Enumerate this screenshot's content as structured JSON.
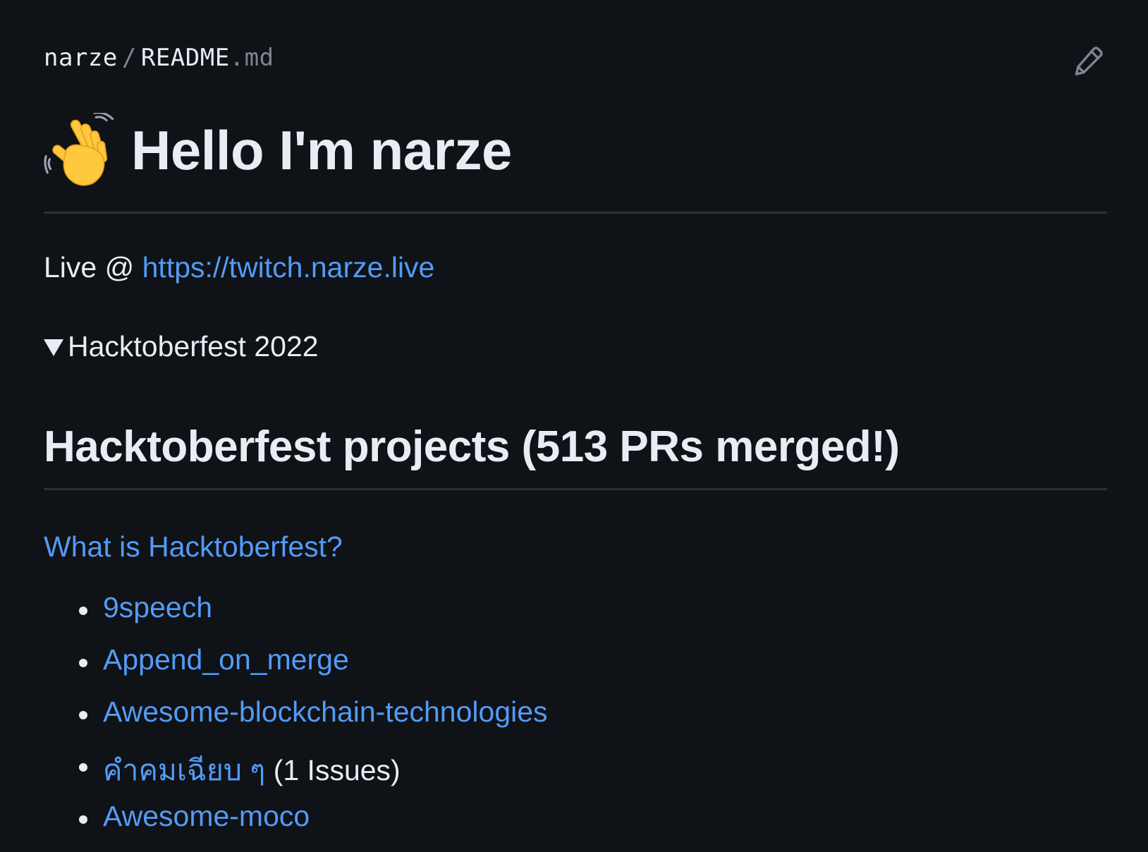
{
  "breadcrumb": {
    "owner": "narze",
    "separator": "/",
    "file_base": "README",
    "file_ext": ".md"
  },
  "header": {
    "title": "Hello I'm narze",
    "title_icon": "waving-hand-icon",
    "edit_icon": "pencil-icon"
  },
  "live": {
    "prefix": "Live @ ",
    "url_text": "https://twitch.narze.live"
  },
  "details": {
    "summary": "Hacktoberfest 2022"
  },
  "section": {
    "heading": "Hacktoberfest projects (513 PRs merged!)",
    "what_link": "What is Hacktoberfest?"
  },
  "projects": [
    {
      "label": "9speech",
      "suffix": ""
    },
    {
      "label": "Append_on_merge",
      "suffix": ""
    },
    {
      "label": "Awesome-blockchain-technologies",
      "suffix": ""
    },
    {
      "label": "คำคมเฉียบ ๆ",
      "suffix": " (1 Issues)"
    },
    {
      "label": "Awesome-moco",
      "suffix": ""
    }
  ],
  "colors": {
    "background": "#0f1217",
    "text": "#e6edf3",
    "link": "#539bf5",
    "divider": "#2b3139",
    "muted": "#7d8590"
  }
}
